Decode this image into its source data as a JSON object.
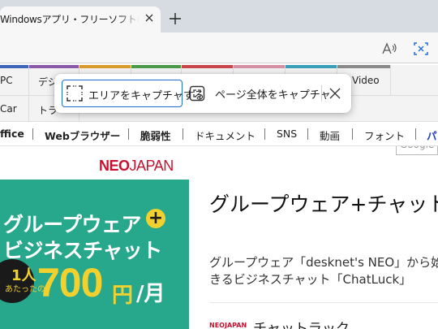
{
  "browser": {
    "tab_title": "Windowsアプリ・フリーソフトのおすすめ",
    "icons": {
      "tab_close": "close-icon",
      "new_tab": "plus-icon",
      "read_aloud": "read-aloud-icon",
      "web_capture": "web-capture-icon"
    }
  },
  "site": {
    "categories_row1": [
      {
        "label": "PC",
        "color": "#3e66b8"
      },
      {
        "label": "デジ",
        "color": "#8a5aa8"
      },
      {
        "label": "",
        "color": "#d99a2b"
      },
      {
        "label": "",
        "color": "#4a9a4a"
      },
      {
        "label": "",
        "color": "#c7474b"
      },
      {
        "label": "",
        "color": "#d68fa3"
      },
      {
        "label": "",
        "color": "#3a9fb8"
      },
      {
        "label": "Video",
        "color": "#8a8a8a"
      }
    ],
    "categories_row2": [
      {
        "label": "Car"
      },
      {
        "label": "トラ"
      }
    ],
    "search_placeholder": "Google",
    "tags": [
      "ffice",
      "Webブラウザー",
      "脆弱性",
      "ドキュメント",
      "SNS",
      "動画",
      "フォント",
      "パ"
    ],
    "ad": {
      "logo_red": "NEO",
      "logo_thin": "JAPAN",
      "line1": "グループウェア",
      "plus": "+",
      "line2": "ビジネスチャット",
      "badge_top": "1人",
      "badge_bottom": "あたったの",
      "price": "700",
      "yen": "円",
      "per_month": "/月"
    },
    "article": {
      "headline": "グループウェア+チャット",
      "desc_line1": "グループウェア「desknet's NEO」から始",
      "desc_line2": "きるビジネスチャット「ChatLuck」",
      "next_logo": "NEOJAPAN",
      "next_title": "チャットラック"
    }
  },
  "capture_popup": {
    "area_label": "エリアをキャプチャする",
    "full_label": "ページ全体をキャプチャ",
    "accent": "#1f6fd0",
    "icons": {
      "area": "area-select-icon",
      "full": "full-page-icon",
      "close": "close-icon"
    }
  }
}
